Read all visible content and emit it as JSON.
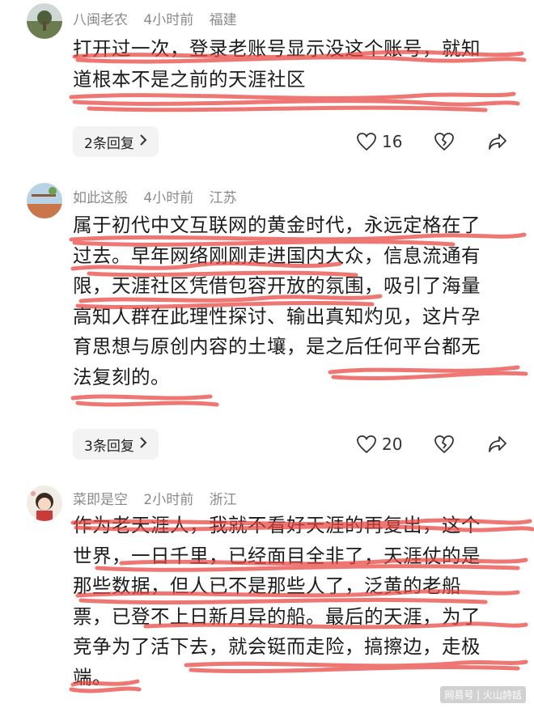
{
  "comments": [
    {
      "user": "八闽老农",
      "time": "4小时前",
      "location": "福建",
      "lines": [
        "打开过一次，登录老账号显示没这个账号，就知",
        "道根本不是之前的天涯社区"
      ],
      "replies_label": "2条回复",
      "like_count": "16"
    },
    {
      "user": "如此这般",
      "time": "4小时前",
      "location": "江苏",
      "lines": [
        "属于初代中文互联网的黄金时代，永远定格在了",
        "过去。早年网络刚刚走进国内大众，信息流通有",
        "限，天涯社区凭借包容开放的氛围，吸引了海量",
        "高知人群在此理性探讨、输出真知灼见，这片孕",
        "育思想与原创内容的土壤，是之后任何平台都无",
        "法复刻的。"
      ],
      "replies_label": "3条回复",
      "like_count": "20"
    },
    {
      "user": "菜即是空",
      "time": "2小时前",
      "location": "浙江",
      "lines": [
        "作为老天涯人，我就不看好天涯的再复出，这个",
        "世界，一日千里，已经面目全非了，天涯仗的是",
        "那些数据，但人已不是那些人了，泛黄的老船",
        "票，已登不上日新月异的船。最后的天涯，为了",
        "竞争为了活下去，就会铤而走险，搞擦边，走极",
        "端。"
      ]
    }
  ],
  "watermark": "网易号 | 火山詩話",
  "colors": {
    "highlight": "#e8433f",
    "meta": "#8a8a8a"
  }
}
